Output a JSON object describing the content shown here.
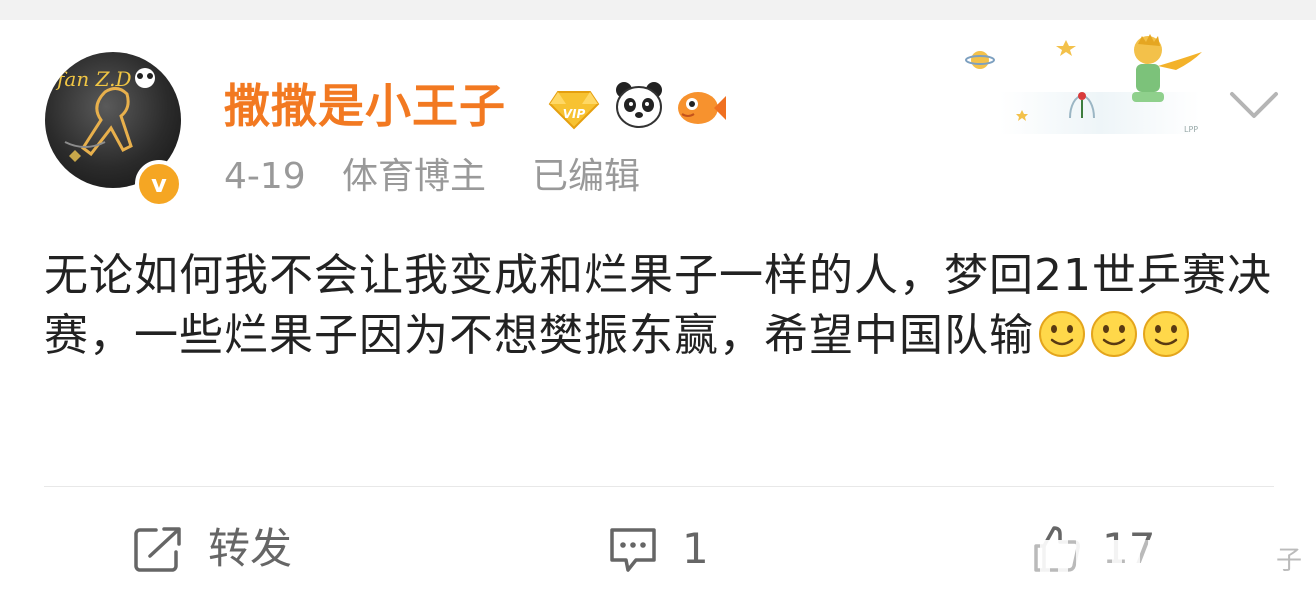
{
  "user": {
    "name": "撒撒是小王子",
    "verified_icon": "verified-v-badge",
    "verified_letter": "v",
    "badges": [
      "vip-diamond-badge",
      "panda-badge",
      "fish-badge"
    ],
    "vip_text": "VIP"
  },
  "meta": {
    "date": "4-19",
    "tag": "体育博主",
    "edited": "已编辑"
  },
  "post": {
    "text": "无论如何我不会让我变成和烂果子一样的人，梦回21世乒赛决赛，一些烂果子因为不想樊振东赢，希望中国队输",
    "emojis": [
      "smile-emoji",
      "smile-emoji",
      "smile-emoji"
    ]
  },
  "actions": {
    "repost_label": "转发",
    "comment_count": "1",
    "like_count": "17"
  },
  "watermark": {
    "char": "子"
  },
  "colors": {
    "username": "#f27921",
    "meta": "#999999",
    "text": "#222222",
    "action": "#666666",
    "badge": "#f5a623"
  }
}
